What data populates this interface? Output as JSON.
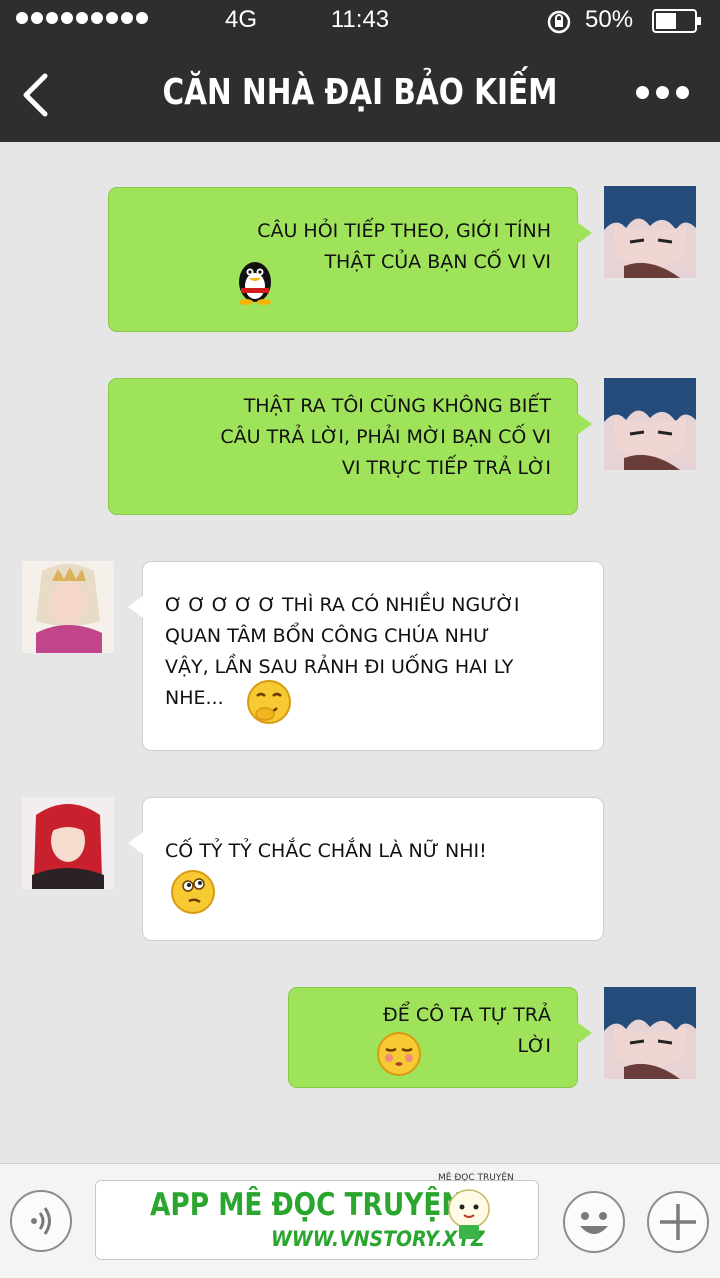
{
  "status_bar": {
    "network": "4G",
    "time": "11:43",
    "battery": "50%"
  },
  "header": {
    "title": "CĂN NHÀ ĐẠI BẢO KIẾM"
  },
  "messages": [
    {
      "side": "right",
      "lines": [
        "CÂU HỎI TIẾP THEO, GIỚI TÍNH",
        "THẬT CỦA BẠN CỐ VI VI"
      ],
      "emoji": "penguin-emoji"
    },
    {
      "side": "right",
      "lines": [
        "THẬT RA TÔI CŨNG KHÔNG BIẾT",
        "CÂU TRẢ LỜI, PHẢI MỜI BẠN CỐ VI",
        "VI TRỰC TIẾP TRẢ LỜI"
      ]
    },
    {
      "side": "left",
      "lines": [
        "Ơ Ơ Ơ Ơ Ơ THÌ RA CÓ NHIỀU NGƯỜI",
        "QUAN TÂM BỔN CÔNG CHÚA NHƯ",
        "VẬY, LẦN SAU RẢNH ĐI UỐNG HAI LY",
        "NHE..."
      ],
      "emoji": "giggle-emoji"
    },
    {
      "side": "left",
      "lines": [
        "CỐ TỶ TỶ CHẮC CHẮN LÀ NỮ NHI!"
      ],
      "emoji": "thinking-emoji"
    },
    {
      "side": "right",
      "lines": [
        "ĐỂ CÔ TA TỰ TRẢ",
        "LỜI"
      ],
      "emoji": "smug-emoji"
    }
  ],
  "input_bar": {
    "watermark_title": "APP MÊ ĐỌC TRUYỆN",
    "watermark_url": "WWW.VNSTORY.XYZ",
    "watermark_small": "MÊ ĐỌC TRUYỆN"
  },
  "colors": {
    "topbar": "#2e2e31",
    "chat_background": "#e6e6e6",
    "sent_bubble": "#9fe35a",
    "received_bubble": "#ffffff",
    "watermark_green": "#2aa52e"
  }
}
